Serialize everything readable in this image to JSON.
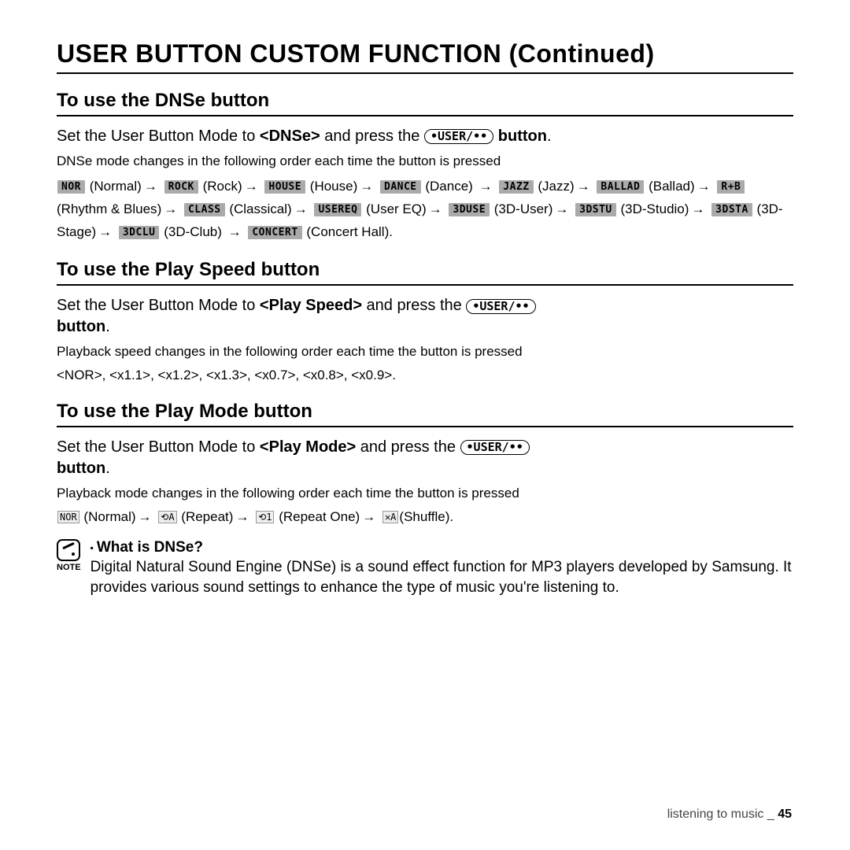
{
  "title": "USER BUTTON CUSTOM FUNCTION (Continued)",
  "user_button_label": "•USER/••",
  "sections": {
    "dnse": {
      "heading": "To use the DNSe button",
      "intro_pre": "Set the User Button Mode to ",
      "intro_mode": "<DNSe>",
      "intro_mid": " and press the ",
      "intro_post": " button",
      "desc": "DNSe mode changes in the following order each time the button is pressed",
      "modes": [
        {
          "badge": "NOR",
          "label": "Normal"
        },
        {
          "badge": "ROCK",
          "label": "Rock"
        },
        {
          "badge": "HOUSE",
          "label": "House"
        },
        {
          "badge": "DANCE",
          "label": "Dance"
        },
        {
          "badge": "JAZZ",
          "label": "Jazz"
        },
        {
          "badge": "BALLAD",
          "label": "Ballad"
        },
        {
          "badge": "R+B",
          "label": "Rhythm & Blues"
        },
        {
          "badge": "CLASS",
          "label": "Classical"
        },
        {
          "badge": "USEREQ",
          "label": "User EQ"
        },
        {
          "badge": "3DUSE",
          "label": "3D-User"
        },
        {
          "badge": "3DSTU",
          "label": "3D-Studio"
        },
        {
          "badge": "3DSTA",
          "label": "3D-Stage"
        },
        {
          "badge": "3DCLU",
          "label": "3D-Club"
        },
        {
          "badge": "CONCERT",
          "label": "Concert Hall"
        }
      ]
    },
    "playspeed": {
      "heading": "To use the Play Speed button",
      "intro_pre": "Set the User Button Mode to ",
      "intro_mode": "<Play Speed>",
      "intro_mid": " and press the ",
      "intro_post": "button",
      "desc": "Playback speed changes in the following order each time the button is pressed",
      "speeds": "<NOR>, <x1.1>, <x1.2>, <x1.3>, <x0.7>, <x0.8>, <x0.9>."
    },
    "playmode": {
      "heading": "To use the Play Mode button",
      "intro_pre": "Set the User Button Mode to ",
      "intro_mode": "<Play Mode>",
      "intro_mid": " and press the ",
      "intro_post": "button",
      "desc": "Playback mode changes in the following order each time the button is pressed",
      "modes": [
        {
          "icon": "NOR",
          "label": "Normal"
        },
        {
          "icon": "⟲A",
          "label": "Repeat"
        },
        {
          "icon": "⟲1",
          "label": "Repeat One"
        },
        {
          "icon": "✕A",
          "label": "Shuffle"
        }
      ]
    }
  },
  "note": {
    "label": "NOTE",
    "title": "What is DNSe?",
    "body": "Digital Natural Sound Engine (DNSe) is a sound effect function for MP3 players developed by Samsung. It provides various sound settings to enhance the type of music you're listening to."
  },
  "footer": {
    "section": "listening to music _",
    "page": "45"
  }
}
